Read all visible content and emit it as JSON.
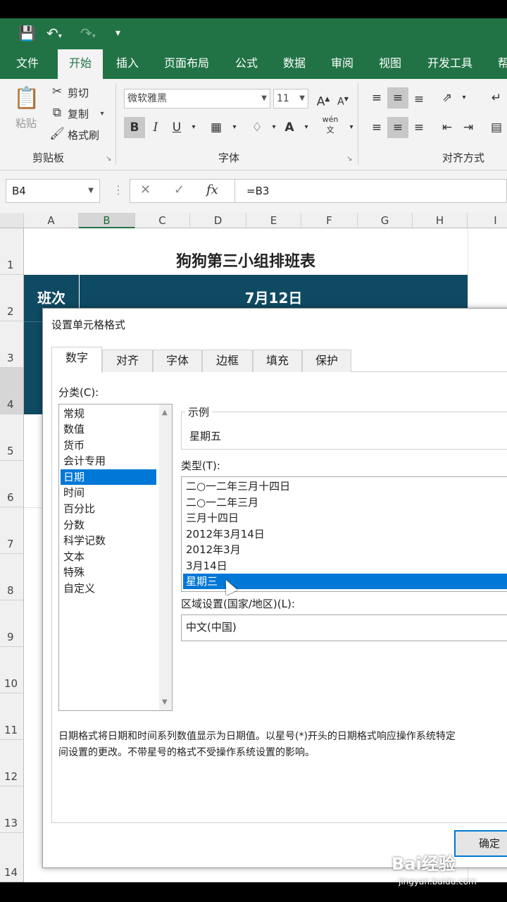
{
  "ribbon_tabs": [
    "文件",
    "开始",
    "插入",
    "页面布局",
    "公式",
    "数据",
    "审阅",
    "视图",
    "开发工具",
    "帮"
  ],
  "clipboard": {
    "paste": "粘贴",
    "cut": "剪切",
    "copy": "复制",
    "format_painter": "格式刷",
    "group": "剪贴板"
  },
  "font": {
    "name": "微软雅黑",
    "size": "11",
    "group": "字体",
    "phonetic": "wén 文"
  },
  "alignment": {
    "group": "对齐方式"
  },
  "formula_bar": {
    "name_box": "B4",
    "formula": "=B3",
    "fx": "fx"
  },
  "sheet": {
    "columns": [
      "A",
      "B",
      "C",
      "D",
      "E",
      "F",
      "G",
      "H",
      "I"
    ],
    "rows": [
      "1",
      "2",
      "3",
      "4",
      "5",
      "6",
      "7",
      "8",
      "9",
      "10",
      "11",
      "12",
      "13",
      "14"
    ],
    "title": "狗狗第三小组排班表",
    "shift_label": "班次",
    "date_header": "7月12日"
  },
  "dialog": {
    "title": "设置单元格格式",
    "tabs": [
      "数字",
      "对齐",
      "字体",
      "边框",
      "填充",
      "保护"
    ],
    "category_label": "分类(C):",
    "categories": [
      "常规",
      "数值",
      "货币",
      "会计专用",
      "日期",
      "时间",
      "百分比",
      "分数",
      "科学记数",
      "文本",
      "特殊",
      "自定义"
    ],
    "selected_category": "日期",
    "sample_label": "示例",
    "sample_value": "星期五",
    "type_label": "类型(T):",
    "types": [
      "二○一二年三月十四日",
      "二○一二年三月",
      "三月十四日",
      "2012年3月14日",
      "2012年3月",
      "3月14日",
      "星期三"
    ],
    "selected_type": "星期三",
    "locale_label": "区域设置(国家/地区)(L):",
    "locale_value": "中文(中国)",
    "description_line1": "日期格式将日期和时间系列数值显示为日期值。以星号(*)开头的日期格式响应操作系统特定",
    "description_line2": "间设置的更改。不带星号的格式不受操作系统设置的影响。",
    "ok": "确定"
  },
  "watermark": {
    "text": "Bai经验",
    "url": "jingyan.baidu.com"
  },
  "colors": {
    "excel_green": "#217346",
    "navy": "#0f4a63",
    "selection": "#0078d7"
  }
}
